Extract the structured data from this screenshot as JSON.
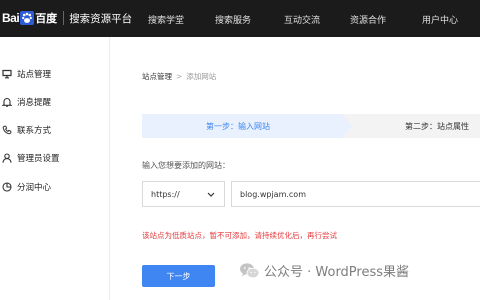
{
  "header": {
    "logo_bai": "Bai",
    "logo_du": "百度",
    "logo_sub": "搜索资源平台",
    "nav": [
      "搜索学堂",
      "搜索服务",
      "互动交流",
      "资源合作",
      "用户中心"
    ]
  },
  "sidebar": {
    "items": [
      {
        "label": "站点管理",
        "icon": "site-manage-icon"
      },
      {
        "label": "消息提醒",
        "icon": "bell-icon"
      },
      {
        "label": "联系方式",
        "icon": "contact-icon"
      },
      {
        "label": "管理员设置",
        "icon": "admin-icon"
      },
      {
        "label": "分润中心",
        "icon": "share-revenue-icon"
      }
    ]
  },
  "breadcrumb": {
    "parent": "站点管理",
    "separator": ">",
    "current": "添加网站"
  },
  "steps": {
    "active": "第一步：输入网站",
    "inactive": "第二步：站点属性"
  },
  "form": {
    "prompt": "输入您想要添加的网站：",
    "protocol_value": "https://",
    "site_value": "blog.wpjam.com",
    "error": "该站点为低质站点，暂不可添加，请持续优化后，再行尝试",
    "next_label": "下一步"
  },
  "watermark": {
    "text": "公众号 · WordPress果酱"
  },
  "colors": {
    "topbar": "#1b1b1b",
    "accent": "#3f86f2",
    "step_active_bg": "#e8f1fd",
    "step_inactive_bg": "#f3f3f3",
    "error": "#e4393c"
  }
}
